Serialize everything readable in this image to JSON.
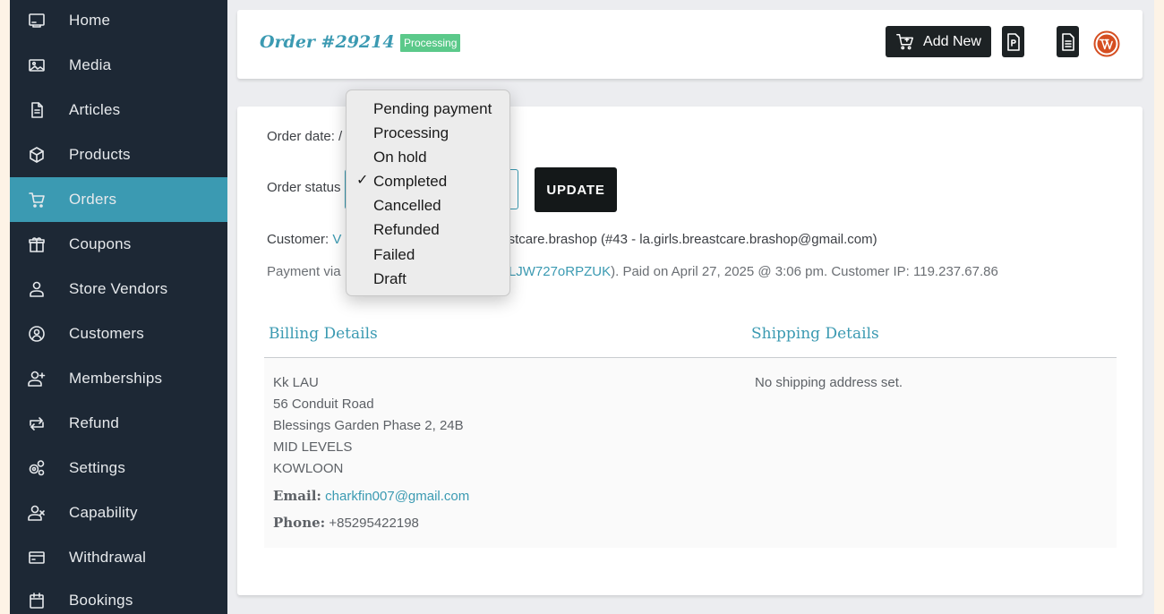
{
  "sidebar": {
    "items": [
      {
        "label": "Home",
        "icon": "monitor-icon"
      },
      {
        "label": "Media",
        "icon": "image-icon"
      },
      {
        "label": "Articles",
        "icon": "document-icon"
      },
      {
        "label": "Products",
        "icon": "cube-icon"
      },
      {
        "label": "Orders",
        "icon": "cart-icon",
        "active": true
      },
      {
        "label": "Coupons",
        "icon": "gift-icon"
      },
      {
        "label": "Store Vendors",
        "icon": "user-icon"
      },
      {
        "label": "Customers",
        "icon": "user-circle-icon"
      },
      {
        "label": "Memberships",
        "icon": "user-plus-icon"
      },
      {
        "label": "Refund",
        "icon": "refund-arrows-icon"
      },
      {
        "label": "Settings",
        "icon": "gears-icon"
      },
      {
        "label": "Capability",
        "icon": "user-x-icon"
      },
      {
        "label": "Withdrawal",
        "icon": "credit-card-icon"
      },
      {
        "label": "Bookings",
        "icon": "calendar-icon"
      }
    ]
  },
  "header": {
    "title": "Order #29214",
    "status_badge": "Processing",
    "add_new_label": "Add New"
  },
  "order": {
    "date_label": "Order date: /",
    "status_label": "Order status",
    "update_label": "UPDATE",
    "customer_prefix": "Customer: ",
    "customer_link": "V",
    "customer_rest": ".breastcare.brashop (#43 - la.girls.breastcare.brashop@gmail.com)",
    "payment_prefix": "Payment via",
    "payment_link": "uSYSLJW727oRPZUK",
    "payment_rest": "). Paid on April 27, 2025 @ 3:06 pm. Customer IP: 119.237.67.86"
  },
  "billing": {
    "title": "Billing Details",
    "lines": [
      "Kk LAU",
      "56 Conduit Road",
      "Blessings Garden Phase 2, 24B",
      "MID LEVELS",
      "KOWLOON"
    ],
    "email_label": "Email:",
    "email": "charkfin007@gmail.com",
    "phone_label": "Phone:",
    "phone": "+85295422198"
  },
  "shipping": {
    "title": "Shipping Details",
    "empty_text": "No shipping address set."
  },
  "status_dropdown": {
    "options": [
      "Pending payment",
      "Processing",
      "On hold",
      "Completed",
      "Cancelled",
      "Refunded",
      "Failed",
      "Draft"
    ],
    "selected": "Completed",
    "check_mark": "✓"
  },
  "colors": {
    "sidebar_bg": "#1d2835",
    "accent": "#3b9ab2",
    "badge": "#5bc98a",
    "wordpress": "#d54e21"
  }
}
